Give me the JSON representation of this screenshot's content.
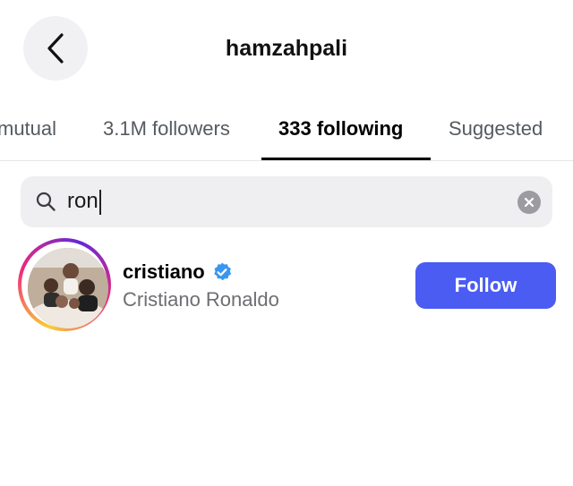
{
  "header": {
    "title": "hamzahpali",
    "back_icon": "chevron-left-icon"
  },
  "tabs": [
    {
      "label": "mutual",
      "active": false
    },
    {
      "label": "3.1M followers",
      "active": false
    },
    {
      "label": "333 following",
      "active": true
    },
    {
      "label": "Suggested",
      "active": false
    }
  ],
  "search": {
    "value": "ron",
    "icon": "search-icon",
    "clear_icon": "clear-icon"
  },
  "results": [
    {
      "username": "cristiano",
      "full_name": "Cristiano Ronaldo",
      "verified": true,
      "follow_label": "Follow"
    }
  ],
  "colors": {
    "follow_button": "#4a5cf2",
    "verified_badge": "#3897f0",
    "search_bg": "#efeff1",
    "secondary_text": "#6e6e73"
  }
}
